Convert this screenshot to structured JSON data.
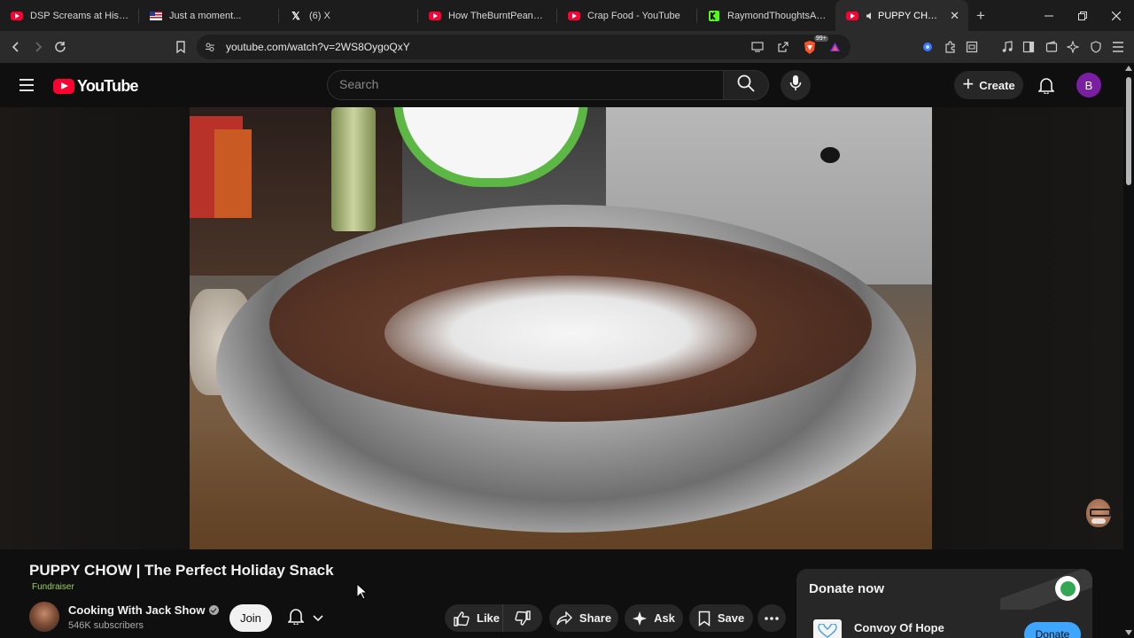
{
  "browser": {
    "tabs": [
      {
        "title": "DSP Screams at His TV as",
        "favicon": "youtube-icon"
      },
      {
        "title": "Just a moment...",
        "favicon": "flag-icon"
      },
      {
        "title": "(6) X",
        "favicon": "x-icon"
      },
      {
        "title": "How TheBurntPeanut Too",
        "favicon": "youtube-icon"
      },
      {
        "title": "Crap Food - YouTube",
        "favicon": "youtube-icon"
      },
      {
        "title": "RaymondThoughtsAndMi",
        "favicon": "kick-icon"
      },
      {
        "title": "PUPPY CHOW | The",
        "favicon": "youtube-icon",
        "active": true
      }
    ],
    "url": "youtube.com/watch?v=2WS8OygoQxY",
    "brave_badge": "99+"
  },
  "youtube": {
    "logo_text": "YouTube",
    "search_placeholder": "Search",
    "create_label": "Create",
    "account_initial": "B",
    "account_color": "#7b1fa2"
  },
  "video": {
    "title": "PUPPY CHOW | The Perfect Holiday Snack",
    "badge": "Fundraiser",
    "channel": {
      "name": "Cooking With Jack Show",
      "subscribers": "546K subscribers",
      "join_label": "Join"
    },
    "actions": {
      "like": "Like",
      "share": "Share",
      "ask": "Ask",
      "save": "Save"
    }
  },
  "donate_panel": {
    "title": "Donate now",
    "organization": "Convoy Of Hope",
    "button_label": "Donate"
  },
  "colors": {
    "background": "#0f0f0f",
    "brand_red": "#ff0033",
    "donate_blue": "#3ea6ff",
    "fundraiser_green": "#9bd15b"
  }
}
